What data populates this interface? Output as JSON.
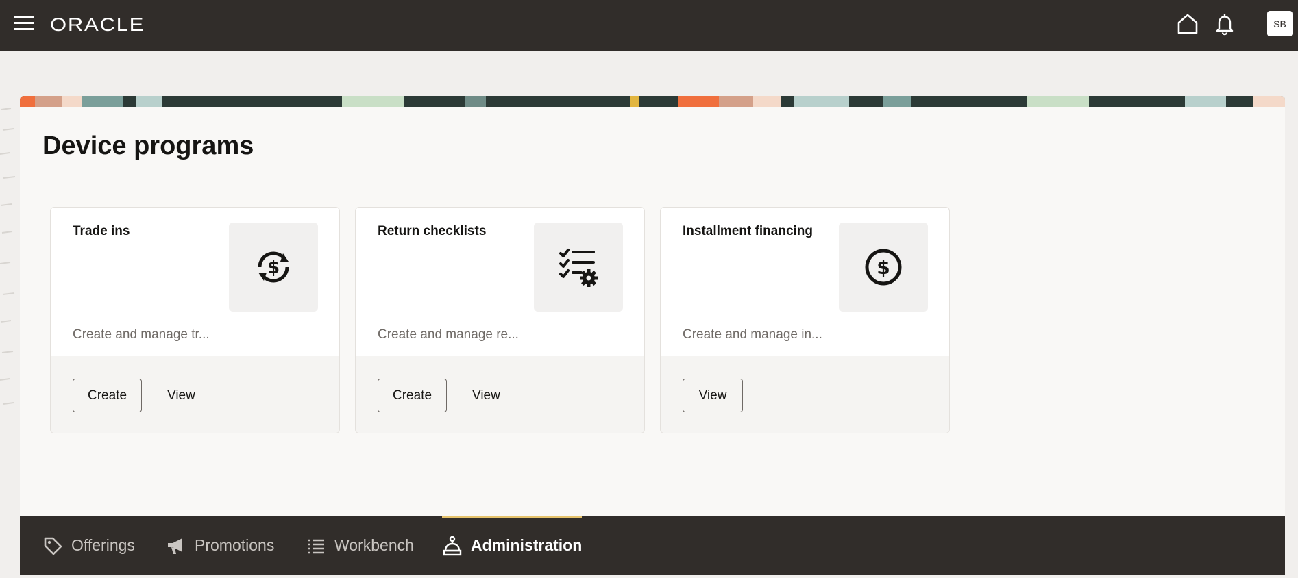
{
  "header": {
    "logo": "ORACLE",
    "avatar_initials": "SB",
    "icons": [
      "menu-icon",
      "home-icon",
      "bell-icon"
    ]
  },
  "page": {
    "title": "Device programs"
  },
  "cards": [
    {
      "title": "Trade ins",
      "description": "Create and manage tr...",
      "icon": "dollar-refresh-icon",
      "create_label": "Create",
      "view_label": "View"
    },
    {
      "title": "Return checklists",
      "description": "Create and manage re...",
      "icon": "checklist-gear-icon",
      "create_label": "Create",
      "view_label": "View"
    },
    {
      "title": "Installment financing",
      "description": "Create and manage in...",
      "icon": "dollar-circle-icon",
      "view_label": "View"
    }
  ],
  "bottom_nav": {
    "items": [
      {
        "label": "Offerings",
        "icon": "tag-icon",
        "active": false
      },
      {
        "label": "Promotions",
        "icon": "megaphone-icon",
        "active": false
      },
      {
        "label": "Workbench",
        "icon": "list-icon",
        "active": false
      },
      {
        "label": "Administration",
        "icon": "admin-icon",
        "active": true
      }
    ]
  },
  "colors": {
    "header_bg": "#312d2a",
    "active_tab_indicator": "#e6c36c",
    "page_bg": "#f1efed",
    "panel_bg": "#f9f8f6"
  }
}
